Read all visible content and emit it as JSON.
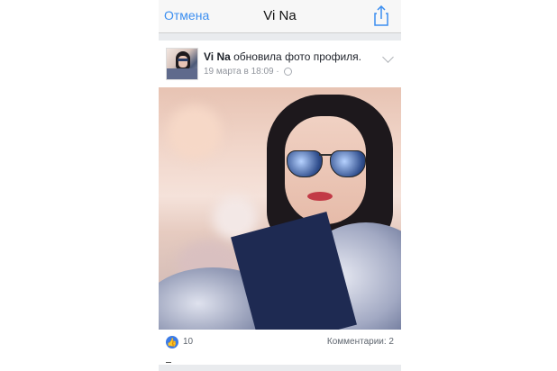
{
  "navbar": {
    "cancel_label": "Отмена",
    "title": "Vi Na",
    "share_icon": "share-icon"
  },
  "post": {
    "author": "Vi Na",
    "action": " обновила фото профиля.",
    "date": "19 марта в 18:09 · ",
    "privacy_icon": "globe-icon",
    "menu_icon": "chevron-down-icon",
    "likes": "10",
    "comments": "Комментарии: 2"
  },
  "colors": {
    "accent": "#3b8ef0",
    "like": "#3b7be6",
    "meta": "#90949c"
  }
}
